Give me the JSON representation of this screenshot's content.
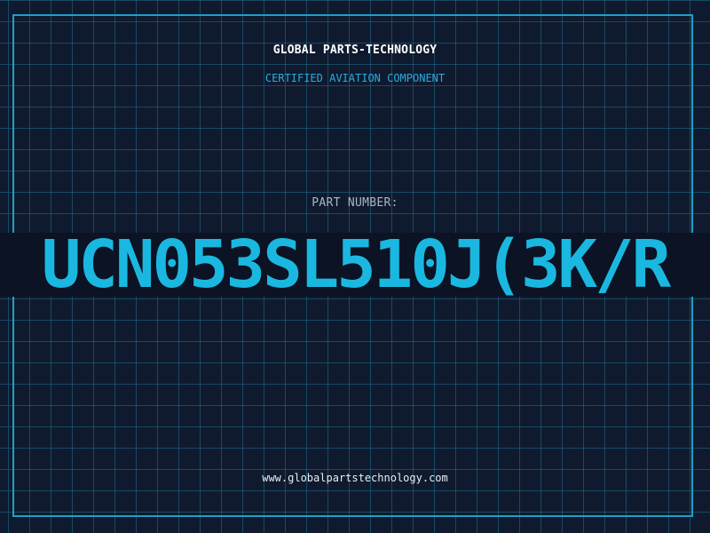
{
  "header": {
    "company": "GLOBAL PARTS-TECHNOLOGY",
    "tagline": "CERTIFIED AVIATION COMPONENT"
  },
  "part": {
    "label": "PART NUMBER:",
    "number": "UCN053SL510J(3K/R"
  },
  "footer": {
    "website": "www.globalpartstechnology.com"
  },
  "colors": {
    "background": "#101a2e",
    "grid": "#206e8c",
    "frame": "#1f9fc7",
    "accent": "#1ab8e0",
    "title": "#ffffff"
  }
}
